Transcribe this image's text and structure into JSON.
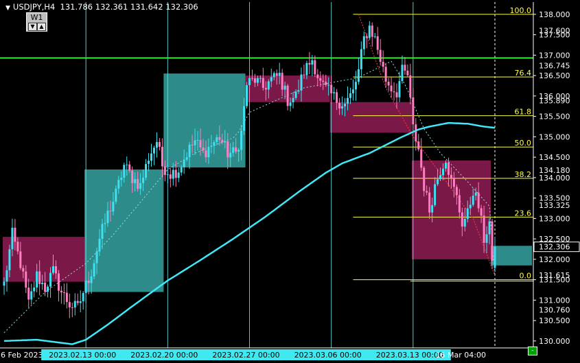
{
  "header": {
    "symbol": "USDJPY,H4",
    "open": "131.786",
    "high": "132.361",
    "low": "131.642",
    "close": "132.306",
    "timeframe_button": "W1",
    "btn_down": "▼",
    "btn_up": "▲"
  },
  "colors": {
    "background": "#000000",
    "bull_candle": "#40e0f0",
    "bear_candle": "#ff7fc0",
    "ma_line": "#40e8f8",
    "green_level": "#33ee33",
    "fib": "#ffff44",
    "cyan_zone": "#2d8c8a",
    "magenta_zone": "#7a1848",
    "vertical_lines": "#6fe6ea",
    "axis_text": "#ffffff"
  },
  "chart_data": {
    "type": "candlestick",
    "symbol": "USDJPY",
    "timeframe": "H4",
    "ylim": [
      129.83,
      138.3
    ],
    "y_ticks": [
      "138.000",
      "137.500",
      "137.000",
      "136.500",
      "136.000",
      "135.500",
      "135.000",
      "134.500",
      "134.000",
      "133.500",
      "133.000",
      "132.500",
      "132.000",
      "131.500",
      "131.000",
      "130.500",
      "130.000"
    ],
    "y_ticks_values": [
      138.0,
      137.5,
      137.0,
      136.5,
      136.0,
      135.5,
      135.0,
      134.5,
      134.0,
      133.5,
      133.0,
      132.5,
      132.0,
      131.5,
      131.0,
      130.5,
      130.0
    ],
    "price_markers": [
      {
        "label": "137.600",
        "value": 137.6
      },
      {
        "label": "136.745",
        "value": 136.745
      },
      {
        "label": "135.890",
        "value": 135.89
      },
      {
        "label": "134.180",
        "value": 134.18
      },
      {
        "label": "133.325",
        "value": 133.325
      },
      {
        "label": "132.306",
        "value": 132.306,
        "current": true
      },
      {
        "label": "131.615",
        "value": 131.615
      },
      {
        "label": "130.760",
        "value": 130.76
      }
    ],
    "x_labels": [
      {
        "label": "6 Feb 2023",
        "bar": 0,
        "boxed": false
      },
      {
        "label": "2023.02.13 00:00",
        "bar": 30,
        "boxed": true
      },
      {
        "label": "2023.02.20 00:00",
        "bar": 60,
        "boxed": true
      },
      {
        "label": "2023.02.27 00:00",
        "bar": 90,
        "boxed": true
      },
      {
        "label": "2023.03.06 00:00",
        "bar": 120,
        "boxed": true
      },
      {
        "label": "2023.03.13 00:00",
        "bar": 150,
        "boxed": true
      },
      {
        "label": "16 Mar 04:00",
        "bar": 170,
        "boxed": false
      }
    ],
    "x_clipped": [
      "22",
      "eb",
      "00"
    ],
    "total_bars": 181,
    "vertical_bars": [
      30,
      60,
      90,
      120,
      150
    ],
    "dashed_vertical_bar": 180,
    "horizontal_level": {
      "value": 136.93,
      "color": "green"
    },
    "fibonacci": {
      "high": 138.0,
      "low": 131.5,
      "start_bar": 128,
      "end_bar": 181,
      "levels": [
        {
          "ratio": 1.0,
          "label": "100.0"
        },
        {
          "ratio": 0.764,
          "label": "76.4"
        },
        {
          "ratio": 0.618,
          "label": "61.8"
        },
        {
          "ratio": 0.5,
          "label": "50.0"
        },
        {
          "ratio": 0.382,
          "label": "38.2"
        },
        {
          "ratio": 0.236,
          "label": "23.6"
        },
        {
          "ratio": 0.0,
          "label": "0.0"
        }
      ],
      "extra_start_bar": 149,
      "extra_ratio": 0.0
    },
    "zones": [
      {
        "kind": "bear",
        "bar_start": 0,
        "bar_end": 29,
        "top": 132.55,
        "bottom": 131.45
      },
      {
        "kind": "bull",
        "bar_start": 30,
        "bar_end": 58,
        "top": 134.2,
        "bottom": 131.2
      },
      {
        "kind": "bull",
        "bar_start": 59,
        "bar_end": 88,
        "top": 136.55,
        "bottom": 134.25
      },
      {
        "kind": "bear",
        "bar_start": 89,
        "bar_end": 119,
        "top": 136.5,
        "bottom": 135.85
      },
      {
        "kind": "bear",
        "bar_start": 120,
        "bar_end": 149,
        "top": 135.85,
        "bottom": 135.1
      },
      {
        "kind": "bear",
        "bar_start": 150,
        "bar_end": 178,
        "top": 134.42,
        "bottom": 132.0
      },
      {
        "kind": "bull",
        "bar_start": 179,
        "bar_end": 195,
        "top": 132.33,
        "bottom": 131.85
      }
    ],
    "ma": {
      "anchors": [
        [
          0,
          130.0
        ],
        [
          12,
          130.03
        ],
        [
          25,
          129.92
        ],
        [
          30,
          130.03
        ],
        [
          38,
          130.4
        ],
        [
          46,
          130.8
        ],
        [
          60,
          131.48
        ],
        [
          72,
          131.98
        ],
        [
          84,
          132.5
        ],
        [
          96,
          133.05
        ],
        [
          108,
          133.65
        ],
        [
          118,
          134.12
        ],
        [
          124,
          134.35
        ],
        [
          134,
          134.6
        ],
        [
          146,
          135.0
        ],
        [
          152,
          135.18
        ],
        [
          156,
          135.25
        ],
        [
          163,
          135.34
        ],
        [
          170,
          135.32
        ],
        [
          176,
          135.25
        ],
        [
          180,
          135.22
        ]
      ]
    },
    "dashed_trend": {
      "anchors": [
        [
          0,
          130.2
        ],
        [
          15,
          131.2
        ],
        [
          30,
          131.9
        ],
        [
          40,
          132.6
        ],
        [
          60,
          134.2
        ],
        [
          70,
          134.6
        ],
        [
          85,
          135.0
        ],
        [
          90,
          135.6
        ],
        [
          110,
          136.2
        ],
        [
          130,
          136.45
        ],
        [
          142,
          136.85
        ],
        [
          147,
          136.3
        ],
        [
          154,
          135.2
        ],
        [
          160,
          134.6
        ],
        [
          170,
          133.9
        ],
        [
          178,
          133.3
        ],
        [
          180,
          131.6
        ]
      ]
    },
    "red_dotted_trend": {
      "anchors": [
        [
          130,
          138.0
        ],
        [
          140,
          136.2
        ],
        [
          150,
          135.0
        ],
        [
          160,
          134.1
        ],
        [
          172,
          133.0
        ],
        [
          180,
          131.6
        ]
      ]
    },
    "price_path": [
      [
        0,
        131.4
      ],
      [
        3,
        132.6
      ],
      [
        6,
        131.9
      ],
      [
        9,
        130.9
      ],
      [
        12,
        131.6
      ],
      [
        15,
        131.3
      ],
      [
        18,
        131.7
      ],
      [
        21,
        131.2
      ],
      [
        24,
        130.9
      ],
      [
        27,
        130.8
      ],
      [
        29,
        131.2
      ],
      [
        32,
        131.7
      ],
      [
        35,
        132.5
      ],
      [
        38,
        133.1
      ],
      [
        41,
        133.6
      ],
      [
        44,
        134.3
      ],
      [
        47,
        134.0
      ],
      [
        50,
        133.8
      ],
      [
        53,
        134.5
      ],
      [
        56,
        134.9
      ],
      [
        58,
        134.3
      ],
      [
        61,
        134.1
      ],
      [
        64,
        134.2
      ],
      [
        67,
        134.6
      ],
      [
        70,
        134.9
      ],
      [
        73,
        134.6
      ],
      [
        76,
        134.8
      ],
      [
        79,
        135.0
      ],
      [
        82,
        134.6
      ],
      [
        85,
        134.6
      ],
      [
        87,
        135.1
      ],
      [
        89,
        136.3
      ],
      [
        92,
        136.4
      ],
      [
        95,
        136.2
      ],
      [
        98,
        136.4
      ],
      [
        101,
        136.5
      ],
      [
        104,
        135.9
      ],
      [
        107,
        136.0
      ],
      [
        110,
        136.6
      ],
      [
        113,
        136.9
      ],
      [
        116,
        136.3
      ],
      [
        119,
        136.1
      ],
      [
        122,
        135.9
      ],
      [
        125,
        135.8
      ],
      [
        128,
        136.1
      ],
      [
        130,
        136.6
      ],
      [
        132,
        137.4
      ],
      [
        134,
        137.7
      ],
      [
        136,
        137.4
      ],
      [
        138,
        136.9
      ],
      [
        140,
        136.4
      ],
      [
        142,
        136.2
      ],
      [
        144,
        136.1
      ],
      [
        146,
        136.6
      ],
      [
        148,
        136.5
      ],
      [
        150,
        135.2
      ],
      [
        152,
        134.7
      ],
      [
        154,
        133.8
      ],
      [
        156,
        133.2
      ],
      [
        158,
        133.8
      ],
      [
        160,
        134.2
      ],
      [
        162,
        134.5
      ],
      [
        164,
        133.9
      ],
      [
        166,
        133.5
      ],
      [
        168,
        132.9
      ],
      [
        170,
        133.1
      ],
      [
        172,
        133.7
      ],
      [
        174,
        133.3
      ],
      [
        176,
        132.5
      ],
      [
        178,
        132.9
      ],
      [
        179,
        131.8
      ],
      [
        180,
        132.31
      ]
    ]
  }
}
